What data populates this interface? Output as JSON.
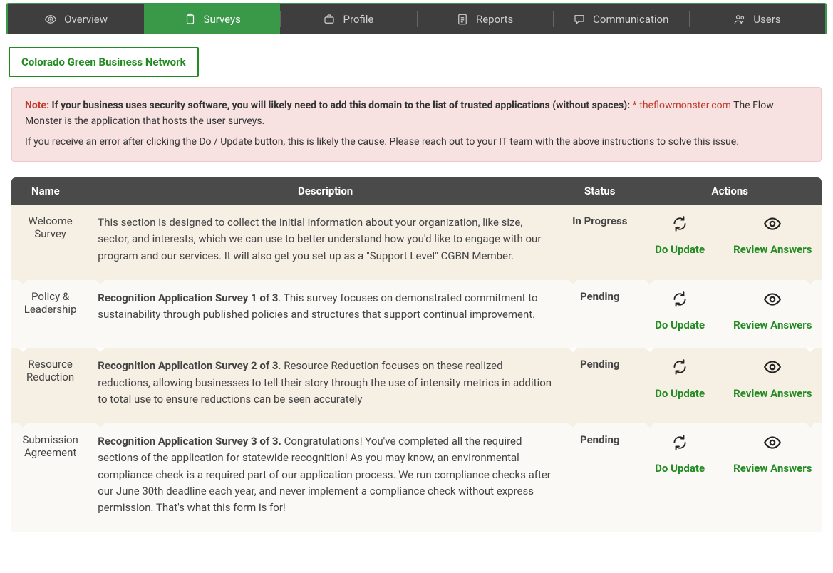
{
  "tabs": [
    {
      "label": "Overview",
      "icon": "eye"
    },
    {
      "label": "Surveys",
      "icon": "clipboard",
      "active": true
    },
    {
      "label": "Profile",
      "icon": "briefcase"
    },
    {
      "label": "Reports",
      "icon": "report"
    },
    {
      "label": "Communication",
      "icon": "chat"
    },
    {
      "label": "Users",
      "icon": "users"
    }
  ],
  "program_badge": "Colorado Green Business Network",
  "note": {
    "label": "Note:",
    "bold_intro": "If your business uses security software, you will likely need to add this domain to the list of trusted applications (without spaces):",
    "domain": "*.theflowmonster.com",
    "after_domain": "The Flow Monster is the application that hosts the user surveys.",
    "line2": "If you receive an error after clicking the Do / Update button, this is likely the cause. Please reach out to your IT team with the above instructions to solve this issue."
  },
  "columns": {
    "name": "Name",
    "description": "Description",
    "status": "Status",
    "actions": "Actions"
  },
  "action_labels": {
    "do_update": "Do Update",
    "review": "Review Answers"
  },
  "rows": [
    {
      "name": "Welcome Survey",
      "desc_bold": "",
      "desc_text": "This section is designed to collect the initial information about your organization, like size, sector, and interests, which we can use to better understand how you'd like to engage with our program and our services. It will also get you set up as a \"Support Level\" CGBN Member.",
      "status": "In Progress"
    },
    {
      "name": "Policy & Leadership",
      "desc_bold": "Recognition Application Survey 1 of 3",
      "desc_text": ". This survey focuses on demonstrated commitment to sustainability through published policies and structures that support continual improvement.",
      "status": "Pending"
    },
    {
      "name": "Resource Reduction",
      "desc_bold": "Recognition Application Survey 2 of 3",
      "desc_text": ". Resource Reduction focuses on these realized reductions, allowing businesses to tell their story through the use of intensity metrics in addition to total use to ensure reductions can be seen accurately",
      "status": "Pending"
    },
    {
      "name": "Submission Agreement",
      "desc_bold": "Recognition Application Survey 3 of 3.",
      "desc_text": " Congratulations! You've completed all the required sections of the application for statewide recognition! As you may know, an environmental compliance check is a required part of our application process. We run compliance checks after our June 30th deadline each year, and never implement a compliance check without express permission. That's what this form is for!",
      "status": "Pending"
    }
  ]
}
